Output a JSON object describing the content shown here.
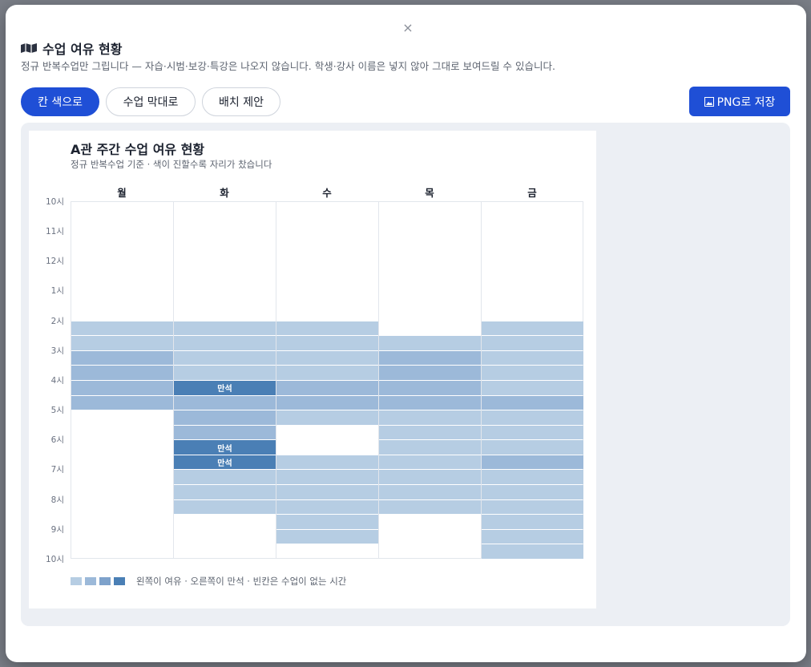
{
  "modal": {
    "close_label": "×",
    "title": "수업 여유 현황",
    "title_icon": "map-icon",
    "subtitle": "정규 반복수업만 그립니다 — 자습·시범·보강·특강은 나오지 않습니다. 학생·강사 이름은 넣지 않아 그대로 보여드릴 수 있습니다."
  },
  "toolbar": {
    "view_buttons": [
      {
        "label": "칸 색으로",
        "active": true
      },
      {
        "label": "수업 막대로",
        "active": false
      },
      {
        "label": "배치 제안",
        "active": false
      }
    ],
    "save_label": "PNG로 저장",
    "save_icon": "image-icon"
  },
  "chart_data": {
    "type": "heatmap",
    "title": "A관 주간 수업 여유 현황",
    "subtitle": "정규 반복수업 기준 · 색이 진할수록 자리가 찼습니다",
    "days": [
      "월",
      "화",
      "수",
      "목",
      "금"
    ],
    "hour_labels": [
      "10시",
      "11시",
      "12시",
      "1시",
      "2시",
      "3시",
      "4시",
      "5시",
      "6시",
      "7시",
      "8시",
      "9시",
      "10시"
    ],
    "slot_minutes": 30,
    "start_hour_label": "10시",
    "level_colors": [
      "#b6cde3",
      "#9cb9d9",
      "#7ea2cb",
      "#4a7fb5"
    ],
    "cells": {
      "월": [
        null,
        null,
        null,
        null,
        null,
        null,
        null,
        null,
        1,
        1,
        2,
        2,
        2,
        2,
        null,
        null,
        null,
        null,
        null,
        null,
        null,
        null,
        null,
        null
      ],
      "화": [
        null,
        null,
        null,
        null,
        null,
        null,
        null,
        null,
        1,
        1,
        1,
        1,
        4,
        2,
        2,
        2,
        4,
        4,
        1,
        1,
        1,
        null,
        null,
        null
      ],
      "수": [
        null,
        null,
        null,
        null,
        null,
        null,
        null,
        null,
        1,
        1,
        1,
        1,
        2,
        2,
        1,
        null,
        null,
        1,
        1,
        1,
        1,
        1,
        1,
        null
      ],
      "목": [
        null,
        null,
        null,
        null,
        null,
        null,
        null,
        null,
        null,
        1,
        2,
        2,
        2,
        2,
        1,
        1,
        1,
        1,
        1,
        1,
        1,
        null,
        null,
        null
      ],
      "금": [
        null,
        null,
        null,
        null,
        null,
        null,
        null,
        null,
        1,
        1,
        1,
        1,
        1,
        2,
        1,
        1,
        1,
        2,
        1,
        1,
        1,
        1,
        1,
        1
      ]
    },
    "full_label": "만석",
    "legend_text": "왼쪽이 여유 · 오른쪽이 만석 · 빈칸은 수업이 없는 시간"
  }
}
